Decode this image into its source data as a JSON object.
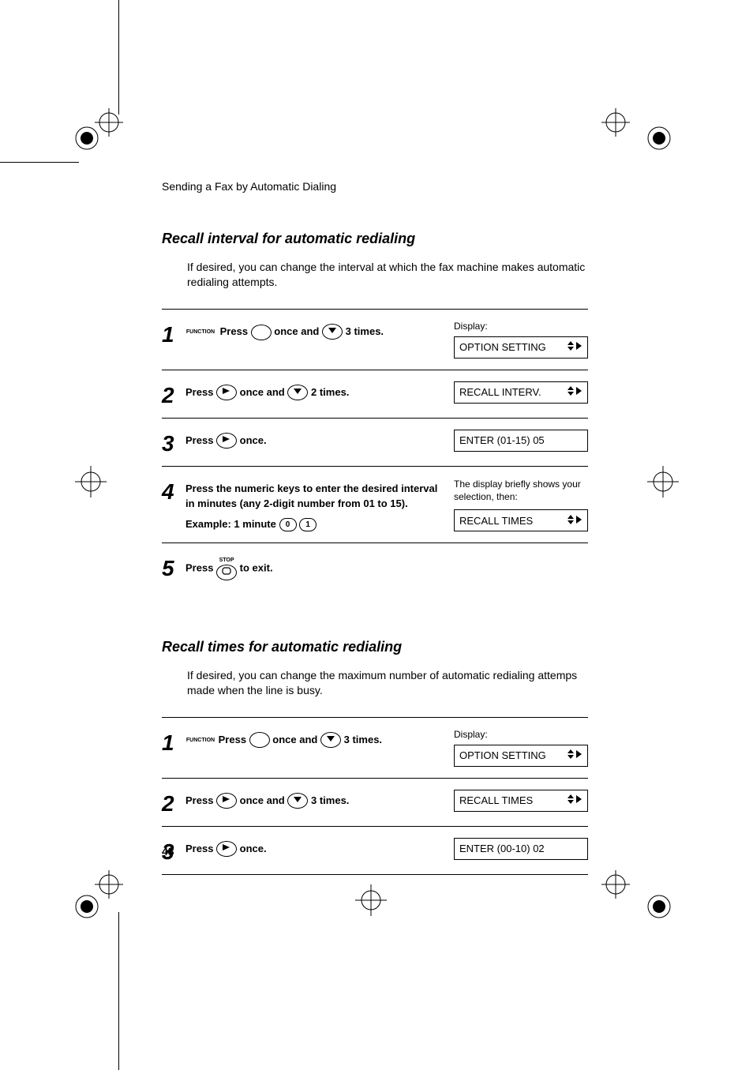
{
  "running_head": "Sending a Fax by Automatic Dialing",
  "page_number": "48",
  "section1": {
    "title": "Recall interval for automatic redialing",
    "intro": "If desired, you can change the interval at which the fax machine makes automatic redialing attempts.",
    "display_label": "Display:",
    "steps": [
      {
        "num": "1",
        "label_function": "FUNCTION",
        "press": "Press",
        "once_and": "once and",
        "times": "3 times.",
        "display": "OPTION SETTING"
      },
      {
        "num": "2",
        "press": "Press",
        "once_and": "once and",
        "times": "2 times.",
        "display": "RECALL INTERV."
      },
      {
        "num": "3",
        "press": "Press",
        "once": "once.",
        "display": "ENTER (01-15) 05"
      },
      {
        "num": "4",
        "body_line1": "Press the numeric keys to enter the desired interval in minutes (any 2-digit number from 01 to 15).",
        "example": "Example: 1 minute",
        "key0": "0",
        "key1": "1",
        "desc1": "The display briefly shows your selection, then:",
        "display": "RECALL TIMES"
      },
      {
        "num": "5",
        "label_stop": "STOP",
        "press": "Press",
        "to_exit": "to exit."
      }
    ]
  },
  "section2": {
    "title": "Recall times for automatic redialing",
    "intro": "If desired, you can change the maximum number of automatic redialing attemps made when the line is busy.",
    "display_label": "Display:",
    "steps": [
      {
        "num": "1",
        "label_function": "FUNCTION",
        "press": "Press",
        "once_and": "once and",
        "times": "3 times.",
        "display": "OPTION SETTING"
      },
      {
        "num": "2",
        "press": "Press",
        "once_and": "once and",
        "times": "3 times.",
        "display": "RECALL TIMES"
      },
      {
        "num": "3",
        "press": "Press",
        "once": "once.",
        "display": "ENTER (00-10) 02"
      }
    ]
  }
}
